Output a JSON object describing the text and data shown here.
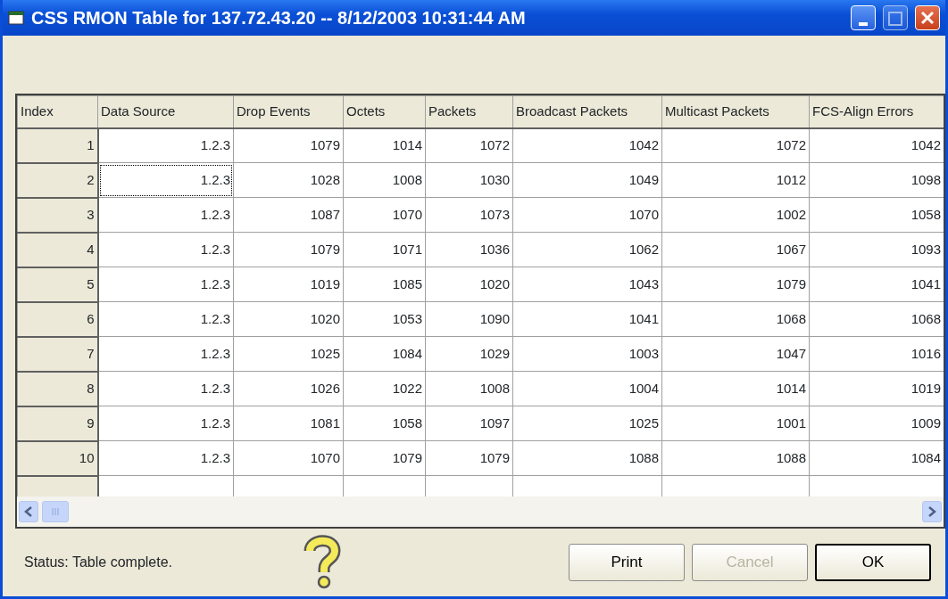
{
  "window": {
    "title": "CSS RMON Table for 137.72.43.20 -- 8/12/2003 10:31:44 AM"
  },
  "table": {
    "columns": [
      "Index",
      "Data Source",
      "Drop Events",
      "Octets",
      "Packets",
      "Broadcast Packets",
      "Multicast Packets",
      "FCS-Align Errors"
    ],
    "rows": [
      {
        "focused": false,
        "cells": [
          "1",
          "1.2.3",
          "1079",
          "1014",
          "1072",
          "1042",
          "1072",
          "1042"
        ]
      },
      {
        "focused": true,
        "cells": [
          "2",
          "1.2.3",
          "1028",
          "1008",
          "1030",
          "1049",
          "1012",
          "1098"
        ]
      },
      {
        "focused": false,
        "cells": [
          "3",
          "1.2.3",
          "1087",
          "1070",
          "1073",
          "1070",
          "1002",
          "1058"
        ]
      },
      {
        "focused": false,
        "cells": [
          "4",
          "1.2.3",
          "1079",
          "1071",
          "1036",
          "1062",
          "1067",
          "1093"
        ]
      },
      {
        "focused": false,
        "cells": [
          "5",
          "1.2.3",
          "1019",
          "1085",
          "1020",
          "1043",
          "1079",
          "1041"
        ]
      },
      {
        "focused": false,
        "cells": [
          "6",
          "1.2.3",
          "1020",
          "1053",
          "1090",
          "1041",
          "1068",
          "1068"
        ]
      },
      {
        "focused": false,
        "cells": [
          "7",
          "1.2.3",
          "1025",
          "1084",
          "1029",
          "1003",
          "1047",
          "1016"
        ]
      },
      {
        "focused": false,
        "cells": [
          "8",
          "1.2.3",
          "1026",
          "1022",
          "1008",
          "1004",
          "1014",
          "1019"
        ]
      },
      {
        "focused": false,
        "cells": [
          "9",
          "1.2.3",
          "1081",
          "1058",
          "1097",
          "1025",
          "1001",
          "1009"
        ]
      },
      {
        "focused": false,
        "cells": [
          "10",
          "1.2.3",
          "1070",
          "1079",
          "1079",
          "1088",
          "1088",
          "1084"
        ]
      }
    ]
  },
  "status": "Status:  Table complete.",
  "buttons": [
    {
      "label": "Print",
      "disabled": false,
      "default": false
    },
    {
      "label": "Cancel",
      "disabled": true,
      "default": false
    },
    {
      "label": "OK",
      "disabled": false,
      "default": true
    }
  ]
}
